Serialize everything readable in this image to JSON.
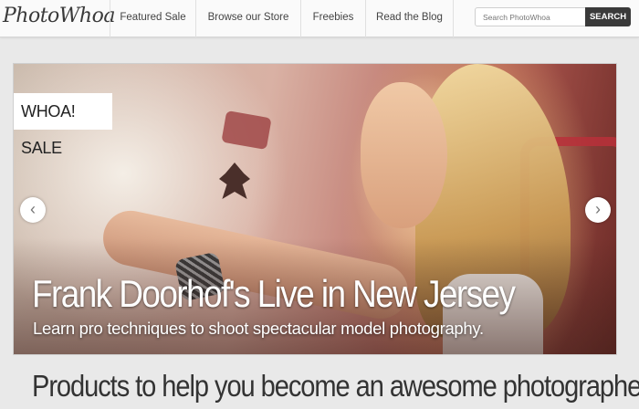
{
  "header": {
    "logo": "PhotoWhoa",
    "nav": [
      {
        "label": "Featured Sale"
      },
      {
        "label": "Browse our Store"
      },
      {
        "label": "Freebies"
      },
      {
        "label": "Read the Blog"
      }
    ],
    "search": {
      "placeholder": "Search PhotoWhoa",
      "button_label": "SEARCH"
    }
  },
  "hero": {
    "badge": "WHOA! SALE",
    "title": "Frank Doorhof's Live in New Jersey",
    "subtitle": "Learn pro techniques to shoot spectacular model photography.",
    "prev_icon": "‹",
    "next_icon": "›"
  },
  "products": {
    "heading": "Products to help you become an awesome photographer"
  },
  "colors": {
    "nav_bg": "#fafafa",
    "search_button_bg": "#3a3a3a",
    "page_bg": "#e9e9e9"
  }
}
